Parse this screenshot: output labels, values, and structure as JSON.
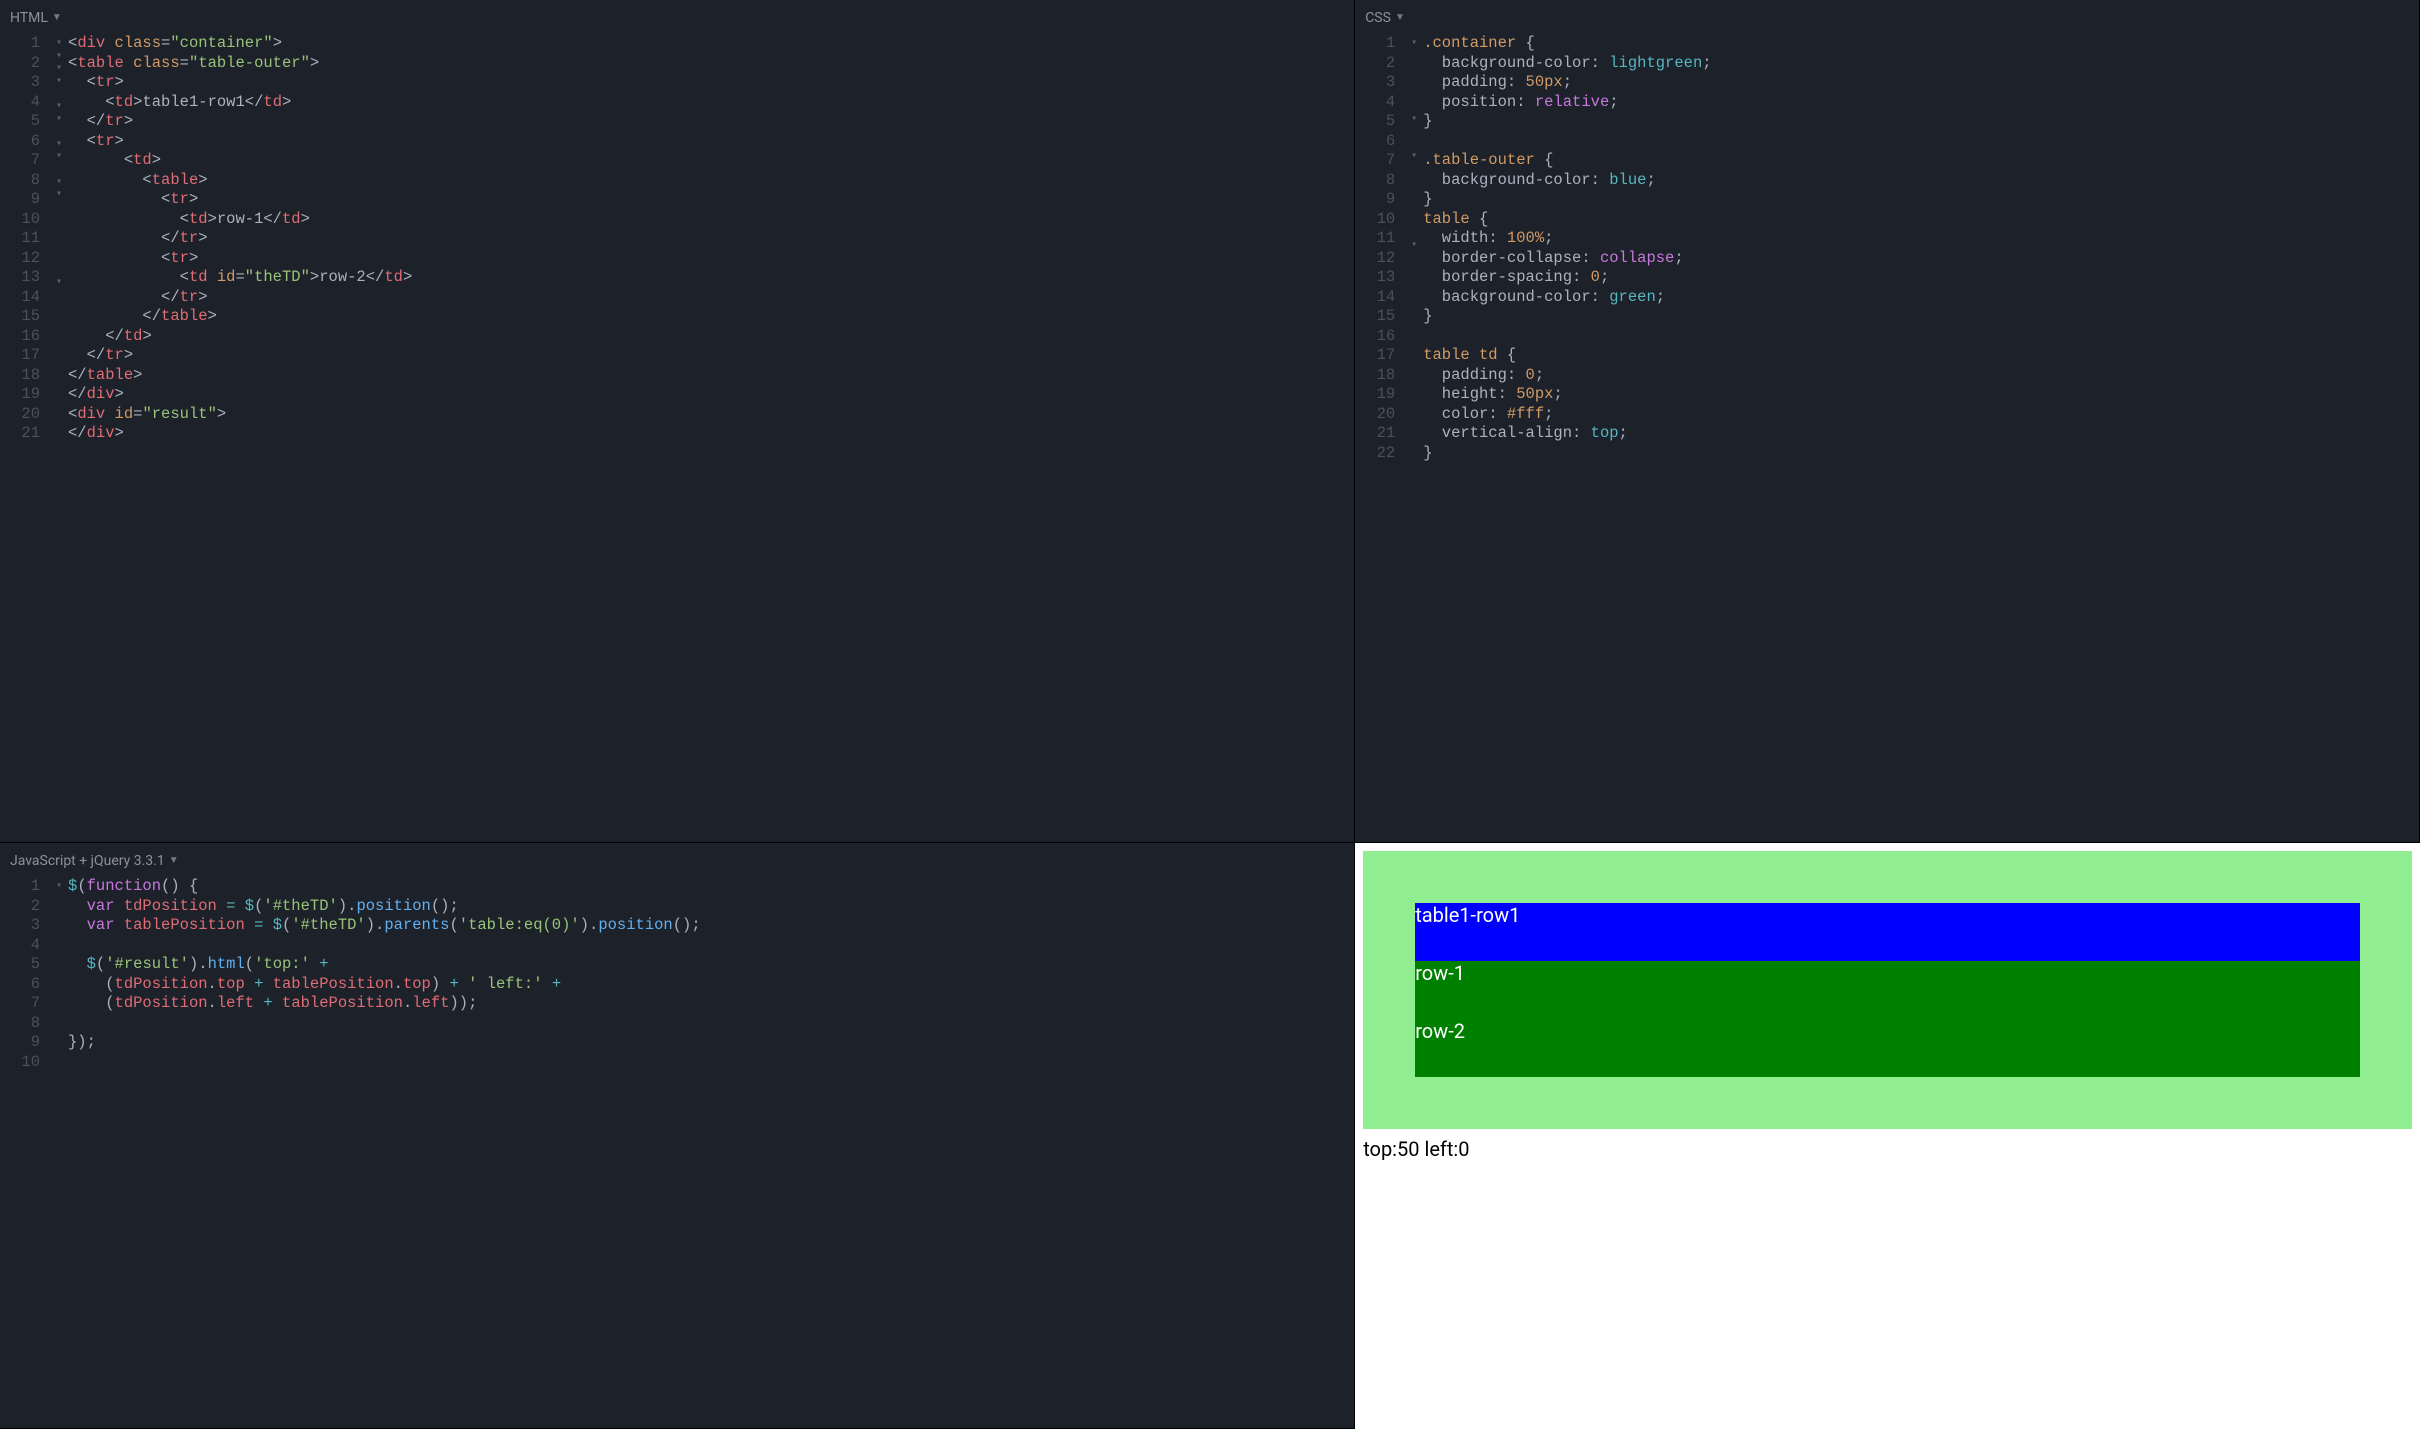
{
  "panes": {
    "html": {
      "title": "HTML"
    },
    "css": {
      "title": "CSS"
    },
    "js": {
      "title": "JavaScript + jQuery 3.3.1"
    }
  },
  "html_code": {
    "lines": [
      1,
      2,
      3,
      4,
      5,
      6,
      7,
      8,
      9,
      10,
      11,
      12,
      13,
      14,
      15,
      16,
      17,
      18,
      19,
      20,
      21
    ],
    "folds": [
      "▾",
      "▾",
      "▾",
      "▾",
      "",
      "▾",
      "▾",
      "",
      "▾",
      "▾",
      "",
      "▾",
      "▾",
      "",
      "",
      "",
      "",
      "",
      "",
      "▾",
      ""
    ],
    "t": {
      "div": "div",
      "class": "class",
      "container": "\"container\"",
      "table": "table",
      "table_outer": "\"table-outer\"",
      "tr": "tr",
      "td": "td",
      "txt1": "table1-row1",
      "row1": "row-1",
      "row2": "row-2",
      "id": "id",
      "theTD": "\"theTD\"",
      "result_id": "\"result\""
    }
  },
  "css_code": {
    "lines": [
      1,
      2,
      3,
      4,
      5,
      6,
      7,
      8,
      9,
      10,
      11,
      12,
      13,
      14,
      15,
      16,
      17,
      18,
      19,
      20,
      21,
      22
    ],
    "folds": [
      "▾",
      "",
      "",
      "",
      "",
      "",
      "▾",
      "",
      "",
      "▾",
      "",
      "",
      "",
      "",
      "",
      "",
      "▾",
      "",
      "",
      "",
      "",
      ""
    ],
    "t": {
      "container": ".container",
      "bgc": "background-color",
      "lightgreen": "lightgreen",
      "padding": "padding",
      "fifty": "50px",
      "position": "position",
      "relative": "relative",
      "table_outer": ".table-outer",
      "blue": "blue",
      "table": "table",
      "width": "width",
      "hundred": "100%",
      "border_collapse": "border-collapse",
      "collapse": "collapse",
      "border_spacing": "border-spacing",
      "zero": "0",
      "green": "green",
      "table_td": "table td",
      "height": "height",
      "color": "color",
      "white": "#fff",
      "valign": "vertical-align",
      "top": "top"
    }
  },
  "js_code": {
    "lines": [
      1,
      2,
      3,
      4,
      5,
      6,
      7,
      8,
      9,
      10
    ],
    "folds": [
      "▾",
      "",
      "",
      "",
      "",
      "",
      "",
      "",
      "",
      ""
    ],
    "t": {
      "dollar": "$",
      "function": "function",
      "var": "var",
      "tdPosition": "tdPosition",
      "theTD": "'#theTD'",
      "position": "position",
      "tablePosition": "tablePosition",
      "parents": "parents",
      "table_eq": "'table:eq(0)'",
      "result": "'#result'",
      "html": "html",
      "top_lit": "'top:'",
      "left_lit": "' left:'",
      "top": "top",
      "left": "left"
    }
  },
  "output": {
    "cells": {
      "r0": "table1-row1",
      "r1": "row-1",
      "r2": "row-2"
    },
    "result_text": "top:50 left:0"
  }
}
